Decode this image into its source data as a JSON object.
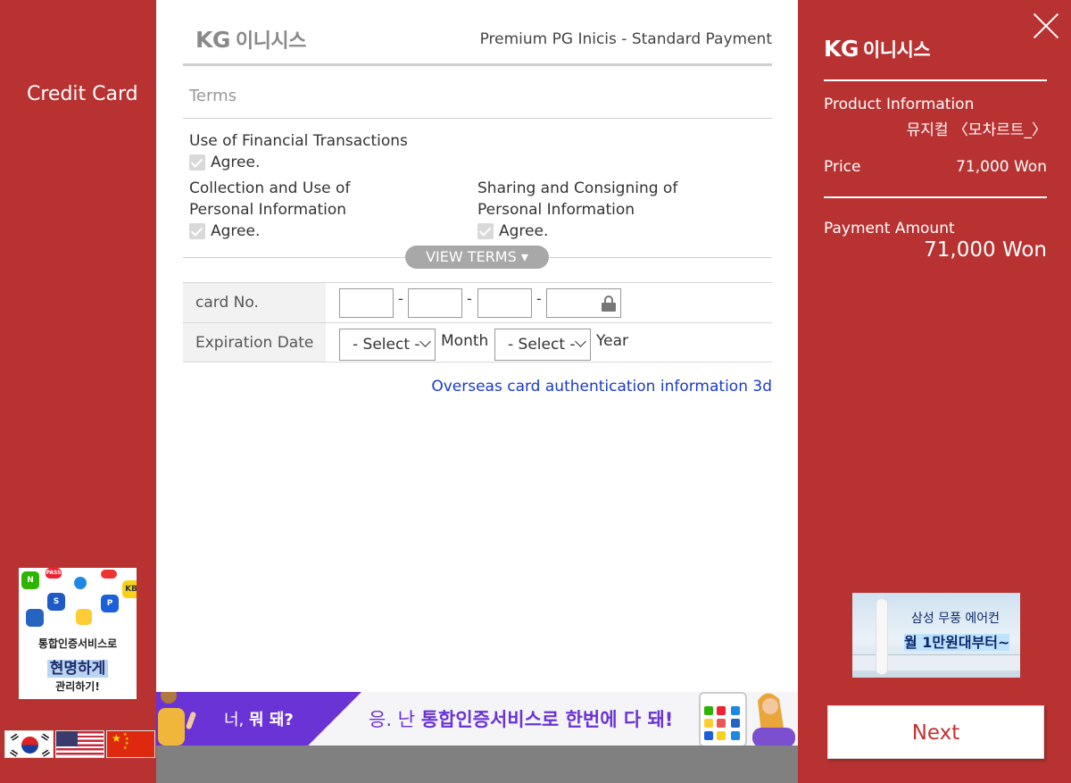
{
  "left": {
    "method_title": "Credit Card",
    "ad": {
      "line1": "통합인증서비스로",
      "line2": "현명하게",
      "line3": "관리하기!"
    },
    "flags": [
      "korean-flag",
      "us-flag",
      "china-flag"
    ]
  },
  "header": {
    "logo_kg": "KG",
    "logo_kr": "이니시스",
    "title": "Premium PG Inicis - Standard Payment"
  },
  "terms": {
    "heading": "Terms",
    "financial": {
      "title": "Use of Financial Transactions",
      "agree": "Agree."
    },
    "collection": {
      "title_line1": "Collection and Use of",
      "title_line2": "Personal Information",
      "agree": "Agree."
    },
    "sharing": {
      "title_line1": "Sharing and Consigning of",
      "title_line2": "Personal Information",
      "agree": "Agree."
    },
    "view_terms": "VIEW TERMS ▾"
  },
  "form": {
    "card_label": "card No.",
    "exp_label": "Expiration Date",
    "month_select": "- Select -",
    "month_unit": "Month",
    "year_select": "- Select -",
    "year_unit": "Year"
  },
  "overseas_link": "Overseas card authentication information 3d",
  "banner": {
    "question_pre": "너,",
    "question_bold": "뭐 돼?",
    "answer_pre": "응. 난",
    "answer_bold": "통합인증서비스로 한번에 다 돼!"
  },
  "right": {
    "logo_kg": "KG",
    "logo_kr": "이니시스",
    "product_label": "Product Information",
    "product_name": "뮤지컬 〈모차르트_〉",
    "price_label": "Price",
    "price_value": "71,000 Won",
    "payment_label": "Payment Amount",
    "payment_value": "71,000 Won",
    "ad": {
      "line1": "삼성 무풍 에어컨",
      "line2": "월 1만원대부터~"
    },
    "next": "Next"
  },
  "colors": {
    "brand_red": "#b83232",
    "link_blue": "#1a3cc8",
    "banner_purple": "#6a33d6"
  }
}
